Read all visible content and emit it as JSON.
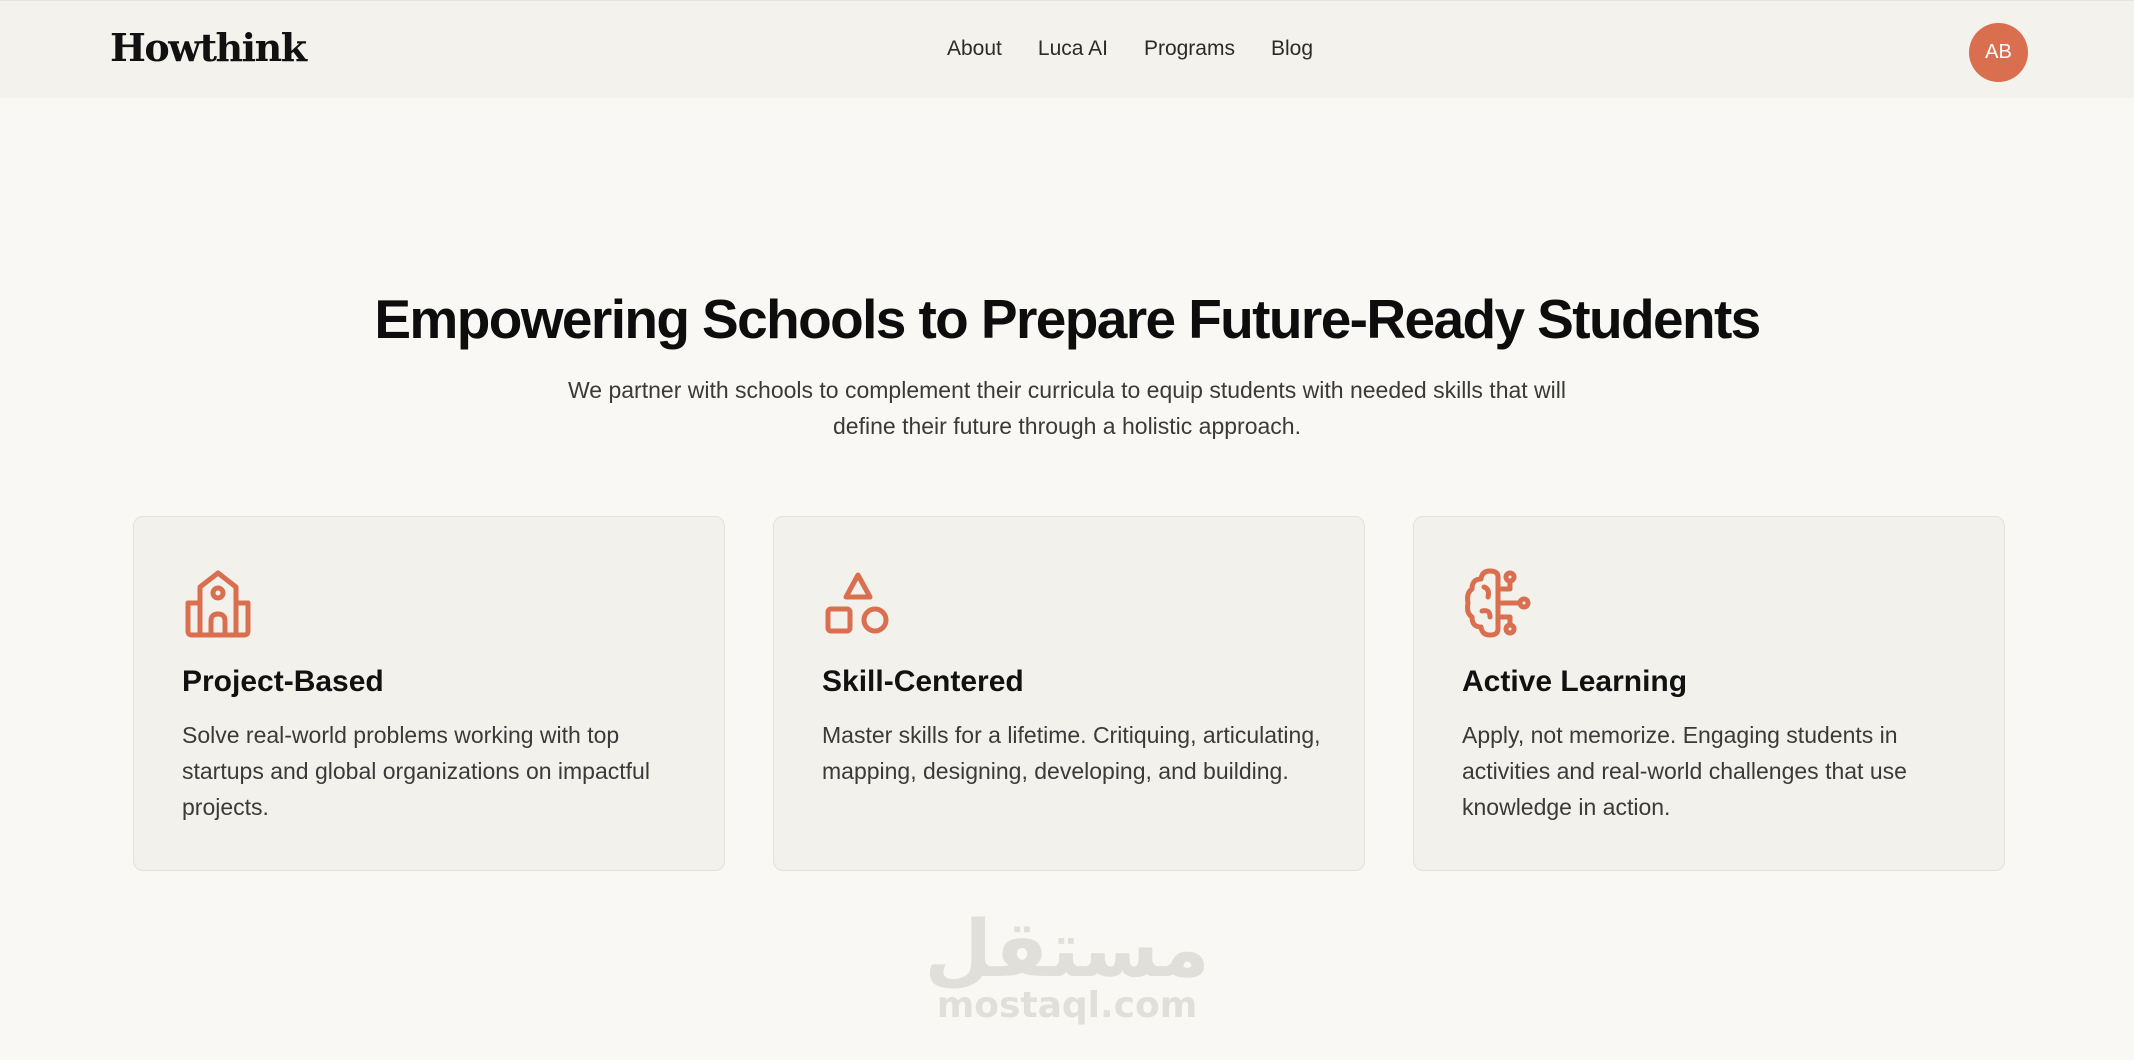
{
  "header": {
    "logo": "Howthink",
    "nav": [
      "About",
      "Luca AI",
      "Programs",
      "Blog"
    ],
    "avatar_initials": "AB"
  },
  "hero": {
    "title": "Empowering Schools to Prepare Future-Ready Students",
    "subtitle": "We partner with schools to complement their curricula to equip students with needed skills that will define their future through a holistic approach."
  },
  "features": [
    {
      "icon": "school-icon",
      "title": "Project-Based",
      "text": "Solve real-world problems working with top startups and global organizations on impactful projects."
    },
    {
      "icon": "shapes-icon",
      "title": "Skill-Centered",
      "text": "Master skills for a lifetime. Critiquing, articulating, mapping, designing, developing, and building."
    },
    {
      "icon": "brain-circuit-icon",
      "title": "Active Learning",
      "text": "Apply, not memorize. Engaging students in activities and real-world challenges that use knowledge in action."
    }
  ],
  "watermark": {
    "arabic": "مستقل",
    "latin": "mostaql.com"
  },
  "colors": {
    "accent": "#d96f4f",
    "background": "#f9f8f4",
    "card": "#f2f1ec"
  }
}
